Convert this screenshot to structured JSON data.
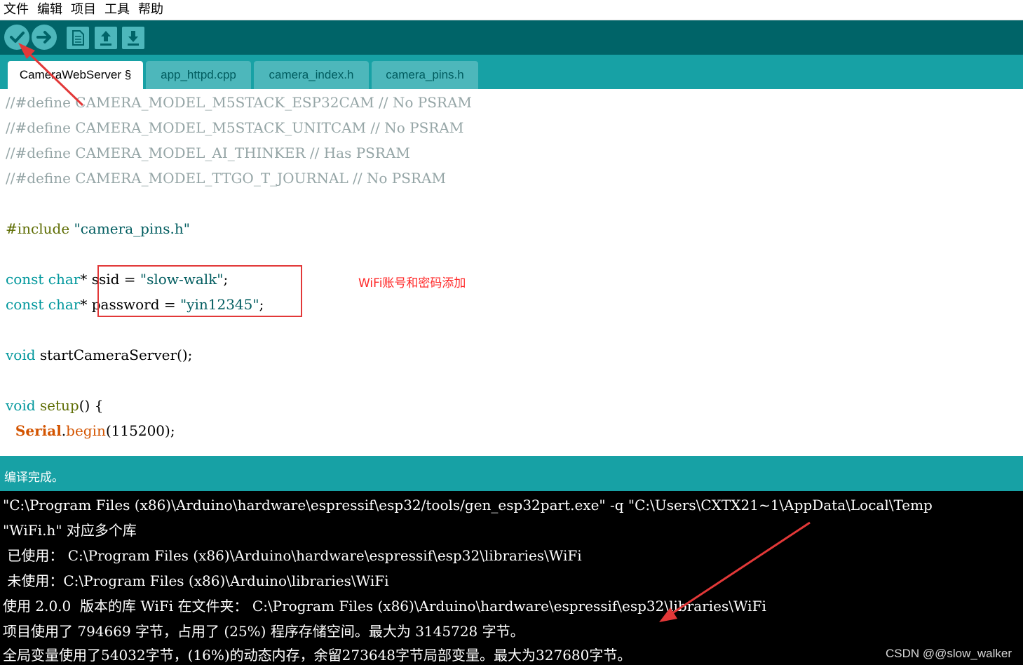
{
  "menubar": {
    "items": [
      "文件",
      "编辑",
      "项目",
      "工具",
      "帮助"
    ]
  },
  "toolbar": {
    "buttons": [
      {
        "icon": "verify-icon",
        "label": ""
      },
      {
        "icon": "upload-icon",
        "label": ""
      },
      {
        "icon": "new-file-icon",
        "label": ""
      },
      {
        "icon": "open-icon",
        "label": ""
      },
      {
        "icon": "save-icon",
        "label": ""
      }
    ]
  },
  "tabs": [
    {
      "label": "CameraWebServer §",
      "active": true
    },
    {
      "label": "app_httpd.cpp",
      "active": false
    },
    {
      "label": "camera_index.h",
      "active": false
    },
    {
      "label": "camera_pins.h",
      "active": false
    }
  ],
  "editor": {
    "lines": [
      "//#define CAMERA_MODEL_M5STACK_ESP32CAM // No PSRAM",
      "//#define CAMERA_MODEL_M5STACK_UNITCAM // No PSRAM",
      "//#define CAMERA_MODEL_AI_THINKER // Has PSRAM",
      "//#define CAMERA_MODEL_TTGO_T_JOURNAL // No PSRAM",
      "",
      "#include \"camera_pins.h\"",
      "",
      "const char* ssid = \"slow-walk\";",
      "const char* password = \"yin12345\";",
      "",
      "void startCameraServer();",
      "",
      "void setup() {",
      "  Serial.begin(115200);"
    ],
    "tokens": {
      "l0": "//#define CAMERA_MODEL_M5STACK_ESP32CAM // No PSRAM",
      "l1": "//#define CAMERA_MODEL_M5STACK_UNITCAM // No PSRAM",
      "l2": "//#define CAMERA_MODEL_AI_THINKER // Has PSRAM",
      "l3": "//#define CAMERA_MODEL_TTGO_T_JOURNAL // No PSRAM",
      "l5_kw": "#include ",
      "l5_str": "\"camera_pins.h\"",
      "l7_kw": "const char",
      "l7_rest": "* ssid = ",
      "l7_str": "\"slow-walk\"",
      "l7_end": ";",
      "l8_kw": "const char",
      "l8_rest": "* password = ",
      "l8_str": "\"yin12345\"",
      "l8_end": ";",
      "l10_kw": "void",
      "l10_rest": " startCameraServer();",
      "l12_kw": "void",
      "l12_fn": " setup",
      "l12_rest": "() {",
      "l13_obj": "  Serial",
      "l13_dot": ".",
      "l13_fn": "begin",
      "l13_rest": "(115200);"
    }
  },
  "annotation": {
    "text": "WiFi账号和密码添加"
  },
  "status": {
    "text": "编译完成。"
  },
  "console": {
    "lines": [
      "\"C:\\Program Files (x86)\\Arduino\\hardware\\espressif\\esp32/tools/gen_esp32part.exe\" -q \"C:\\Users\\CXTX21~1\\AppData\\Local\\Temp",
      "\"WiFi.h\" 对应多个库",
      " 已使用： C:\\Program Files (x86)\\Arduino\\hardware\\espressif\\esp32\\libraries\\WiFi",
      " 未使用：C:\\Program Files (x86)\\Arduino\\libraries\\WiFi",
      "使用 2.0.0  版本的库 WiFi 在文件夹： C:\\Program Files (x86)\\Arduino\\hardware\\espressif\\esp32\\libraries\\WiFi",
      "项目使用了 794669 字节，占用了 (25%) 程序存储空间。最大为 3145728 字节。",
      "全局变量使用了54032字节，(16%)的动态内存，余留273648字节局部变量。最大为327680字节。"
    ]
  },
  "watermark": {
    "text": "CSDN @@slow_walker"
  },
  "colors": {
    "toolbar": "#006468",
    "tabbar": "#17a1a5",
    "button": "#4db7bb",
    "arrow": "#e23838"
  }
}
